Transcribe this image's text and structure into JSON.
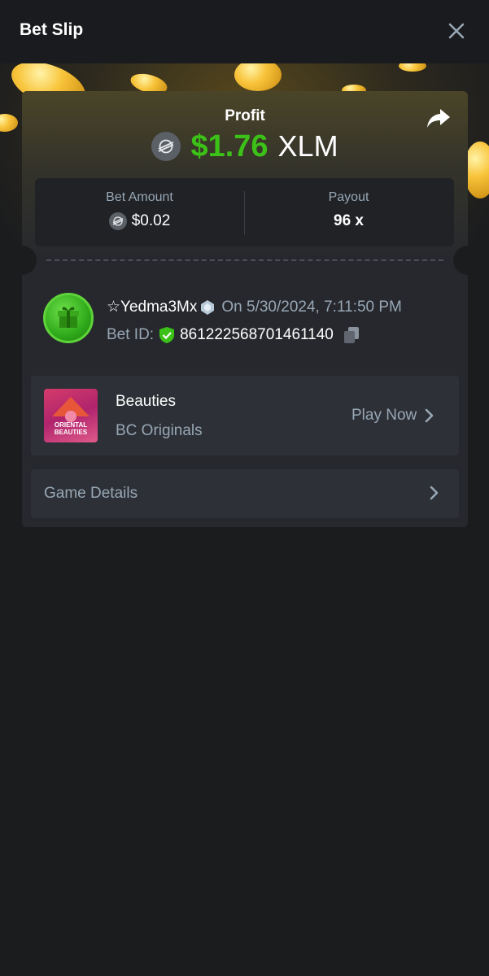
{
  "header": {
    "title": "Bet Slip",
    "close_icon": "close-icon"
  },
  "profit": {
    "label": "Profit",
    "amount": "$1.76",
    "currency": "XLM",
    "amount_color": "#3bc117"
  },
  "stats": {
    "bet_amount_label": "Bet Amount",
    "bet_amount_value": "$0.02",
    "payout_label": "Payout",
    "payout_value": "96 x"
  },
  "user": {
    "name": "☆Yedma3Mx",
    "date": "On 5/30/2024, 7:11:50 PM",
    "bet_id_label": "Bet ID:",
    "bet_id": "861222568701461140"
  },
  "game": {
    "name": "Beauties",
    "provider": "BC Originals",
    "thumb_text_1": "ORIENTAL",
    "thumb_text_2": "BEAUTIES",
    "play_label": "Play Now"
  },
  "details": {
    "label": "Game Details"
  },
  "icons": [
    "close-icon",
    "share-icon",
    "xlm-coin-icon",
    "gift-avatar-icon",
    "shield-check-icon",
    "copy-icon",
    "chevron-right-icon"
  ]
}
